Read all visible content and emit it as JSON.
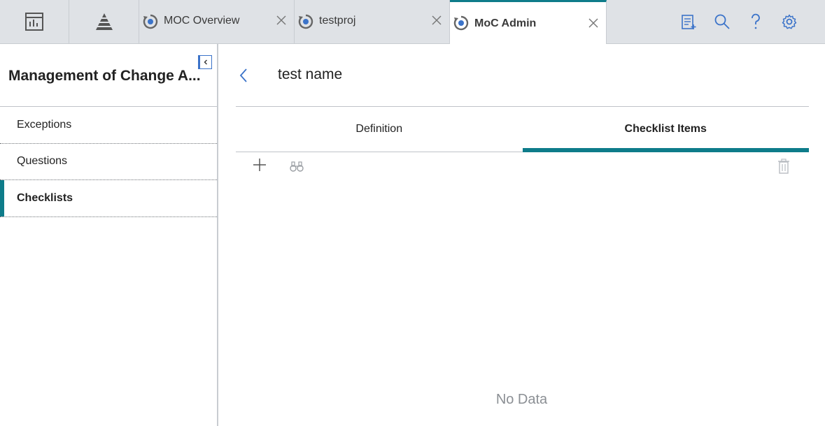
{
  "tabbar": {
    "icon_tabs": [
      {
        "icon": "dashboard-icon"
      },
      {
        "icon": "pyramid-icon"
      }
    ],
    "doc_tabs": [
      {
        "label": "MOC Overview",
        "icon": "moc-refresh-icon",
        "active": false
      },
      {
        "label": "testproj",
        "icon": "moc-refresh-icon",
        "active": false
      },
      {
        "label": "MoC Admin",
        "icon": "moc-refresh-icon",
        "active": true
      }
    ],
    "right_icons": [
      "clipboard-add-icon",
      "search-icon",
      "help-icon",
      "gear-icon"
    ]
  },
  "sidebar": {
    "title": "Management of Change A...",
    "items": [
      {
        "label": "Exceptions",
        "active": false
      },
      {
        "label": "Questions",
        "active": false
      },
      {
        "label": "Checklists",
        "active": true
      }
    ]
  },
  "main": {
    "record_title": "test name",
    "tabs": [
      {
        "label": "Definition",
        "active": false
      },
      {
        "label": "Checklist Items",
        "active": true
      }
    ],
    "toolbar": {
      "add_icon": "plus-icon",
      "find_icon": "binoculars-icon",
      "delete_icon": "trash-icon"
    },
    "empty_text": "No Data"
  },
  "colors": {
    "accent": "#0e7c8a",
    "icon_blue": "#3b73c9",
    "tabbar_bg": "#dfe2e6",
    "muted_text": "#8b8f94"
  }
}
